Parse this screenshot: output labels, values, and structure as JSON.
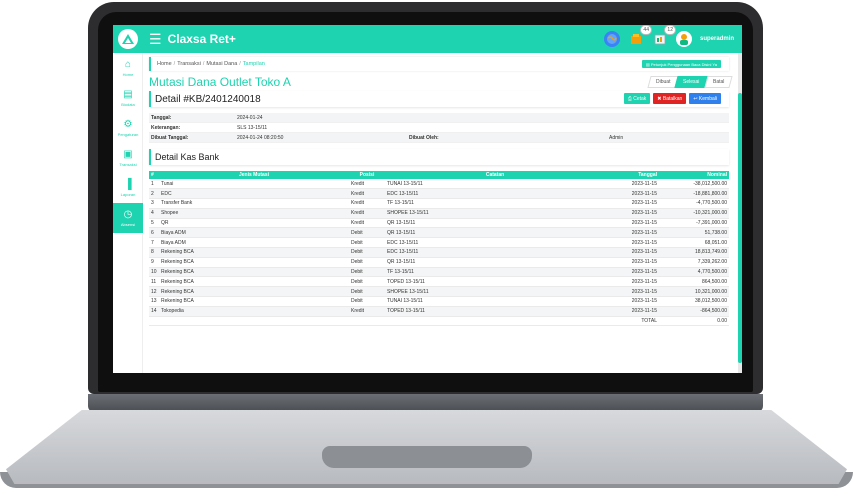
{
  "app": {
    "title": "Claxsa Ret+",
    "user": "superadmin",
    "badges": {
      "cart": "44",
      "notif": "12"
    }
  },
  "sidebar": {
    "items": [
      {
        "label": "Home",
        "icon": "home-icon",
        "glyph": "⌂"
      },
      {
        "label": "Biodata",
        "icon": "id-card-icon",
        "glyph": "▤"
      },
      {
        "label": "Pengaturan",
        "icon": "gear-icon",
        "glyph": "⚙"
      },
      {
        "label": "Transaksi",
        "icon": "basket-icon",
        "glyph": "▣"
      },
      {
        "label": "Laporan",
        "icon": "bar-chart-icon",
        "glyph": "▐"
      },
      {
        "label": "Absensi",
        "icon": "clock-icon",
        "glyph": "◷"
      }
    ]
  },
  "breadcrumb": {
    "home": "Home",
    "transaksi": "Transaksi",
    "mutasi": "Mutasi Dana",
    "current": "Tampilan",
    "guide": "Petunjuk Penggunaan Baca Disini Ya"
  },
  "page": {
    "title": "Mutasi Dana Outlet Toko A",
    "steps": [
      "Dibuat",
      "Selesai",
      "Batal"
    ],
    "detail_title": "Detail #KB/2401240018",
    "actions": {
      "cetak": "Cetak",
      "batalkan": "Batalkan",
      "kembali": "Kembali"
    }
  },
  "info": {
    "tanggal_label": "Tanggal:",
    "tanggal": "2024-01-24",
    "keterangan_label": "Keterangan:",
    "keterangan": "SLS 13-15/11",
    "dibuat_tanggal_label": "Dibuat Tanggal:",
    "dibuat_tanggal": "2024-01-24 08:20:50",
    "dibuat_oleh_label": "Dibuat Oleh:",
    "dibuat_oleh": "Admin"
  },
  "kas": {
    "title": "Detail Kas Bank",
    "columns": [
      "#",
      "Jenis Mutasi",
      "Posisi",
      "Catatan",
      "Tanggal",
      "Nominal"
    ],
    "rows": [
      [
        "1",
        "Tunai",
        "Kredit",
        "TUNAI 13-15/11",
        "2023-11-15",
        "-38,012,500.00"
      ],
      [
        "2",
        "EDC",
        "Kredit",
        "EDC 13-15/11",
        "2023-11-15",
        "-18,881,800.00"
      ],
      [
        "3",
        "Transfer Bank",
        "Kredit",
        "TF 13-15/11",
        "2023-11-15",
        "-4,770,500.00"
      ],
      [
        "4",
        "Shopee",
        "Kredit",
        "SHOPEE 13-15/11",
        "2023-11-15",
        "-10,321,000.00"
      ],
      [
        "5",
        "QR",
        "Kredit",
        "QR 13-15/11",
        "2023-11-15",
        "-7,391,000.00"
      ],
      [
        "6",
        "Biaya ADM",
        "Debit",
        "QR 13-15/11",
        "2023-11-15",
        "51,738.00"
      ],
      [
        "7",
        "Biaya ADM",
        "Debit",
        "EDC 13-15/11",
        "2023-11-15",
        "68,051.00"
      ],
      [
        "8",
        "Rekening BCA",
        "Debit",
        "EDC 13-15/11",
        "2023-11-15",
        "18,813,749.00"
      ],
      [
        "9",
        "Rekening BCA",
        "Debit",
        "QR 13-15/11",
        "2023-11-15",
        "7,339,262.00"
      ],
      [
        "10",
        "Rekening BCA",
        "Debit",
        "TF 13-15/11",
        "2023-11-15",
        "4,770,500.00"
      ],
      [
        "11",
        "Rekening BCA",
        "Debit",
        "TOPED 13-15/11",
        "2023-11-15",
        "864,500.00"
      ],
      [
        "12",
        "Rekening BCA",
        "Debit",
        "SHOPEE 13-15/11",
        "2023-11-15",
        "10,321,000.00"
      ],
      [
        "13",
        "Rekening BCA",
        "Debit",
        "TUNAI 13-15/11",
        "2023-11-15",
        "38,012,500.00"
      ],
      [
        "14",
        "Tokopedia",
        "Kredit",
        "TOPED 13-15/11",
        "2023-11-15",
        "-864,500.00"
      ]
    ],
    "total_label": "TOTAL",
    "total": "0.00"
  }
}
